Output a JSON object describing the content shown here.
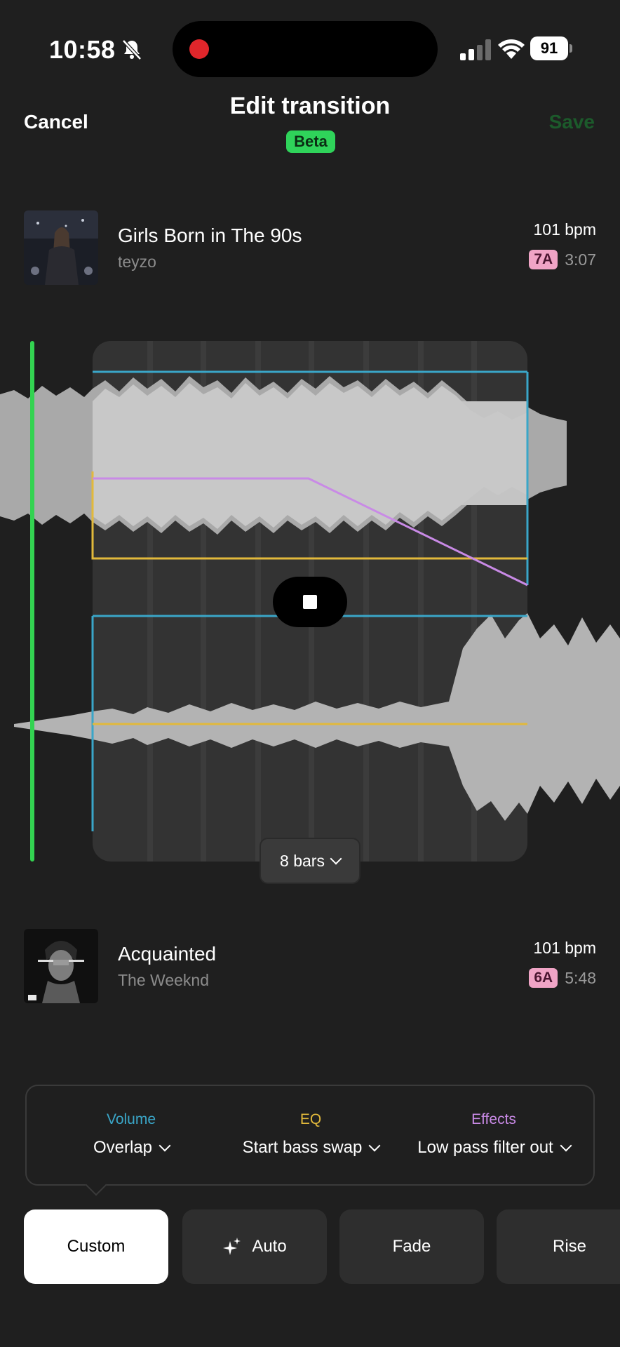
{
  "status_bar": {
    "time": "10:58",
    "battery": "91",
    "icons": [
      "bell-slash-icon",
      "record-icon",
      "signal-icon",
      "wifi-icon",
      "battery-icon"
    ]
  },
  "header": {
    "cancel_label": "Cancel",
    "title": "Edit transition",
    "badge": "Beta",
    "save_label": "Save"
  },
  "track_from": {
    "name": "Girls Born in The 90s",
    "artist": "teyzo",
    "bpm": "101 bpm",
    "key": "7A",
    "duration": "3:07"
  },
  "track_to": {
    "name": "Acquainted",
    "artist": "The Weeknd",
    "bpm": "101 bpm",
    "key": "6A",
    "duration": "5:48"
  },
  "editor": {
    "length_label": "8 bars",
    "colors": {
      "playhead": "#33d351",
      "volume": "#3aa6c8",
      "eq": "#e2b93b",
      "effects": "#c98ae6"
    }
  },
  "controls": {
    "volume": {
      "label": "Volume",
      "value": "Overlap",
      "color": "#3aa6c8"
    },
    "eq": {
      "label": "EQ",
      "value": "Start bass swap",
      "color": "#e2b93b"
    },
    "effects": {
      "label": "Effects",
      "value": "Low pass filter out",
      "color": "#c98ae6"
    }
  },
  "tabs": [
    {
      "label": "Custom",
      "active": true
    },
    {
      "label": "Auto",
      "icon": "sparkles-icon"
    },
    {
      "label": "Fade"
    },
    {
      "label": "Rise"
    }
  ]
}
